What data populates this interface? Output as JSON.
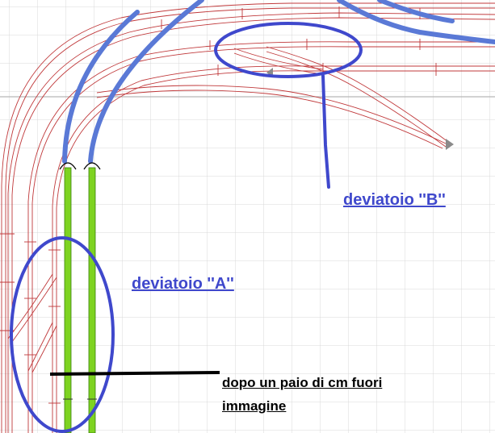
{
  "colors": {
    "grid": "#d9d9d9",
    "track": "#c0393b",
    "highlight_track": "#5a79d6",
    "green_track": "#7ed321",
    "annotation": "#3f48cc",
    "note": "#000000"
  },
  "annotations": {
    "deviatoio_a": "deviatoio ''A''",
    "deviatoio_b": "deviatoio ''B''",
    "note_line1": "dopo un paio di cm fuori",
    "note_line2": "immagine"
  },
  "icons": [
    "turnout-a-ellipse",
    "turnout-b-ellipse",
    "track-end-arrow"
  ]
}
